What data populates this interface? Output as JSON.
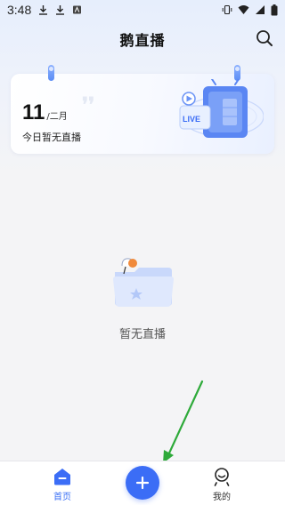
{
  "status_bar": {
    "time": "3:48",
    "left_icons": [
      "download-icon",
      "download-icon",
      "app-notification-icon"
    ],
    "right_icons": [
      "vibrate-icon",
      "wifi-icon",
      "signal-icon",
      "battery-icon"
    ]
  },
  "header": {
    "title": "鹅直播",
    "search_icon": "search-icon"
  },
  "date_card": {
    "day": "11",
    "month": "/二月",
    "status": "今日暂无直播",
    "badge_text": "LIVE"
  },
  "empty_state": {
    "text": "暂无直播"
  },
  "bottom_nav": {
    "items": [
      {
        "label": "首页",
        "icon": "home-icon",
        "active": true
      },
      {
        "label": "我的",
        "icon": "profile-icon",
        "active": false
      }
    ],
    "add_icon": "plus-icon"
  },
  "colors": {
    "accent": "#3b6df6",
    "annotation_arrow": "#2eaa3a"
  }
}
